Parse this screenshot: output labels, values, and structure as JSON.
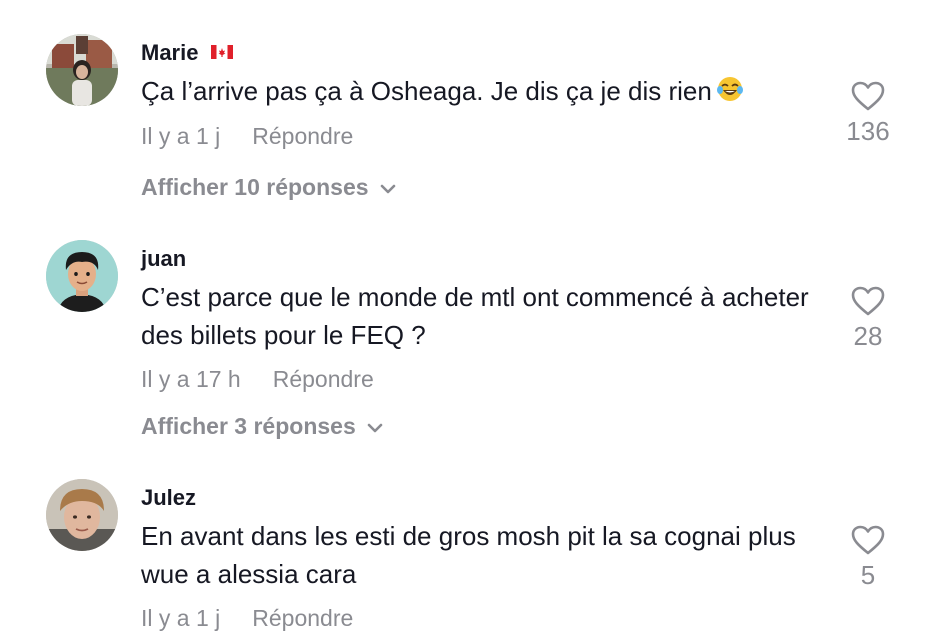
{
  "comments": [
    {
      "author": "Marie",
      "text": "Ça l’arrive pas ça à Osheaga. Je dis ça je dis rien",
      "time": "Il y a 1 j",
      "reply": "Répondre",
      "likes": "136",
      "view_replies": "Afficher 10 réponses"
    },
    {
      "author": "juan",
      "text": "C’est parce que le monde de mtl ont commencé à acheter des billets pour le FEQ ?",
      "time": "Il y a 17 h",
      "reply": "Répondre",
      "likes": "28",
      "view_replies": "Afficher 3 réponses"
    },
    {
      "author": "Julez",
      "text": "En avant dans les esti de gros mosh pit la sa cognai plus wue a alessia cara",
      "time": "Il y a 1 j",
      "reply": "Répondre",
      "likes": "5"
    }
  ],
  "icons": {
    "like": "heart-outline-icon",
    "expand": "chevron-down-icon",
    "flag": "canada-flag-icon",
    "emoji": "tears-of-joy-emoji"
  },
  "colors": {
    "primary_text": "#161823",
    "secondary_text": "#8a8b91"
  }
}
